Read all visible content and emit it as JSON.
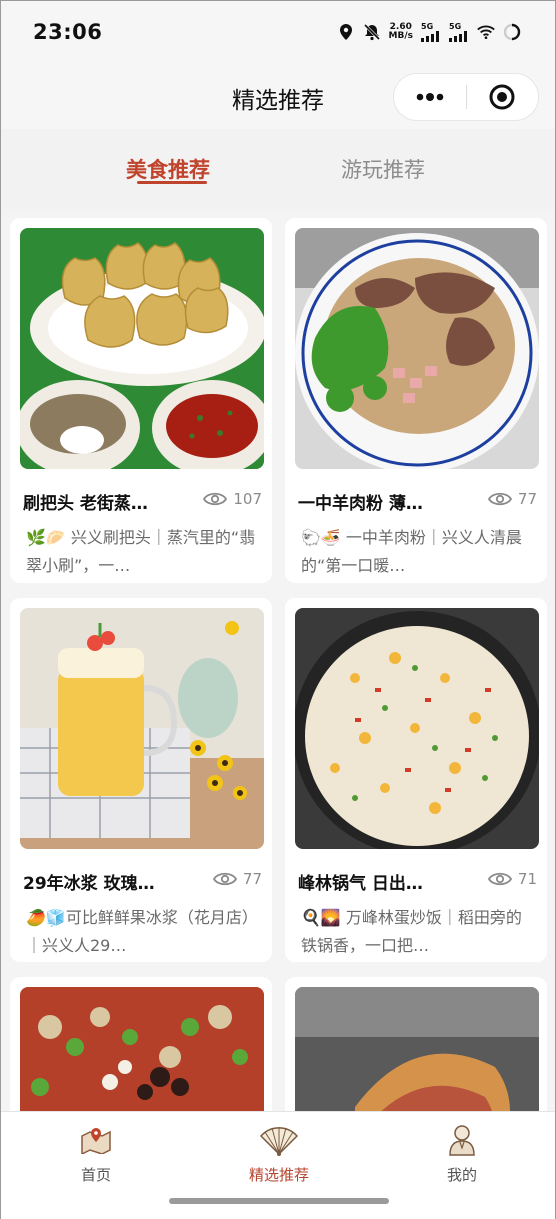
{
  "status_bar": {
    "time": "23:06",
    "net_speed_value": "2.60",
    "net_speed_unit": "MB/s",
    "signal1": "5G",
    "signal2": "5G",
    "icons": [
      "location-icon",
      "mute-icon",
      "signal-icon",
      "wifi-icon",
      "battery-icon"
    ]
  },
  "header": {
    "title": "精选推荐",
    "menu_icon": "more-dots-icon",
    "close_icon": "target-circle-icon"
  },
  "tabs": [
    {
      "label": "美食推荐",
      "active": true
    },
    {
      "label": "游玩推荐",
      "active": false
    }
  ],
  "accent_color": "#c0432c",
  "cards": [
    {
      "title": "刷把头 老街蒸…",
      "views": "107",
      "desc": "🌿🥟 兴义刷把头｜蒸汽里的“翡翠小刷”，一…",
      "image": "shaomai-dumplings"
    },
    {
      "title": "一中羊肉粉 薄…",
      "views": "77",
      "desc": "🐑🍜 一中羊肉粉｜兴义人清晨的“第一口暖…",
      "image": "mutton-noodle-bowl"
    },
    {
      "title": "29年冰浆 玫瑰…",
      "views": "77",
      "desc": "🥭🧊可比鲜鲜果冰浆（花月店）｜兴义人29…",
      "image": "fruit-ice-drink"
    },
    {
      "title": "峰林锅气 日出…",
      "views": "71",
      "desc": "🍳🌄 万峰林蛋炒饭｜稻田旁的铁锅香，一口把…",
      "image": "egg-fried-rice"
    },
    {
      "title": "",
      "views": "",
      "desc": "",
      "image": "spicy-topped-dish"
    },
    {
      "title": "",
      "views": "",
      "desc": "",
      "image": "stuffed-flatbread"
    }
  ],
  "bottom_nav": [
    {
      "label": "首页",
      "icon": "map-pin-icon",
      "active": false
    },
    {
      "label": "精选推荐",
      "icon": "fan-icon",
      "active": true
    },
    {
      "label": "我的",
      "icon": "person-icon",
      "active": false
    }
  ]
}
